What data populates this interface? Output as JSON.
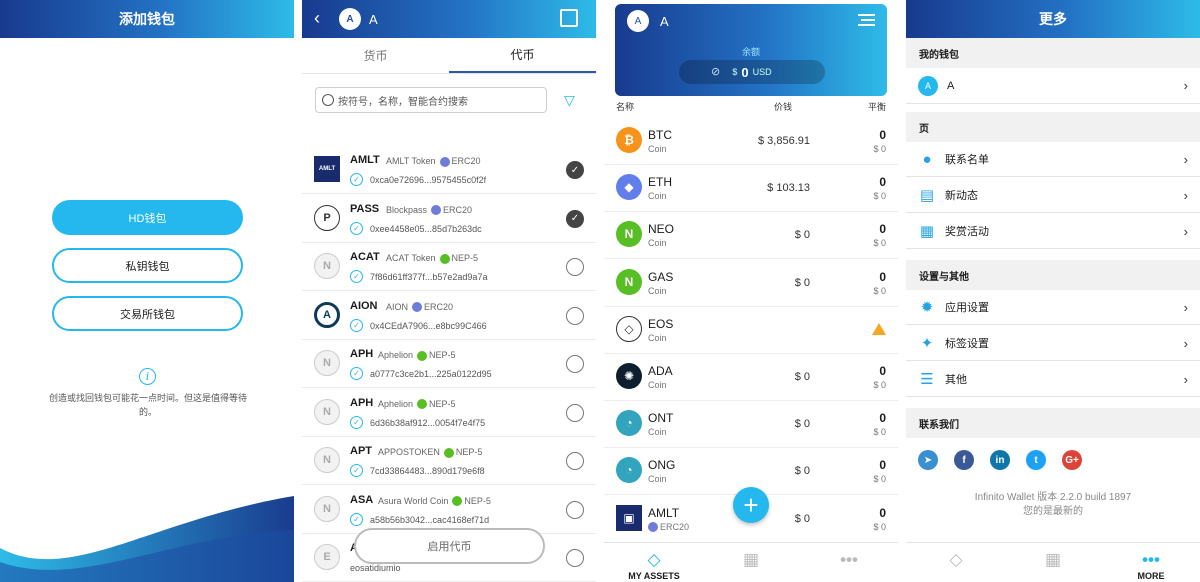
{
  "panel1": {
    "title": "添加钱包",
    "buttons": [
      "HD钱包",
      "私钥钱包",
      "交易所钱包"
    ],
    "info": "i",
    "note": "创造或找回钱包可能花一点时间。但这是值得等待的。"
  },
  "panel2": {
    "wallet_initial": "A",
    "wallet_name": "A",
    "tabs": [
      "货币",
      "代币"
    ],
    "search_placeholder": "按符号，名称，智能合约搜索",
    "tokens": [
      {
        "symbol": "AMLT",
        "name": "AMLT Token",
        "standard": "ERC20",
        "address": "0xca0e72696...9575455c0f2f",
        "selected": true,
        "logo": "AMLT"
      },
      {
        "symbol": "PASS",
        "name": "Blockpass",
        "standard": "ERC20",
        "address": "0xee4458e05...85d7b263dc",
        "selected": true,
        "logo": "P"
      },
      {
        "symbol": "ACAT",
        "name": "ACAT Token",
        "standard": "NEP-5",
        "address": "7f86d61ff377f...b57e2ad9a7a",
        "selected": false,
        "logo": "N"
      },
      {
        "symbol": "AION",
        "name": "AION",
        "standard": "ERC20",
        "address": "0x4CEdA7906...e8bc99C466",
        "selected": false,
        "logo": "A"
      },
      {
        "symbol": "APH",
        "name": "Aphelion",
        "standard": "NEP-5",
        "address": "a0777c3ce2b1...225a0122d95",
        "selected": false,
        "logo": "N"
      },
      {
        "symbol": "APH",
        "name": "Aphelion",
        "standard": "NEP-5",
        "address": "6d36b38af912...0054f7e4f75",
        "selected": false,
        "logo": "N"
      },
      {
        "symbol": "APT",
        "name": "APPOSTOKEN",
        "standard": "NEP-5",
        "address": "7cd33864483...890d179e6f8",
        "selected": false,
        "logo": "N"
      },
      {
        "symbol": "ASA",
        "name": "Asura World Coin",
        "standard": "NEP-5",
        "address": "a58b56b3042...cac4168ef71d",
        "selected": false,
        "logo": "N"
      },
      {
        "symbol": "A",
        "name": "",
        "standard": "",
        "address": "eosatidiumio",
        "selected": false,
        "logo": "E"
      }
    ],
    "enable_button": "启用代币"
  },
  "panel3": {
    "wallet_initial": "A",
    "wallet_name": "A",
    "balance_label": "余额",
    "balance_currency": "$",
    "balance_value": "0",
    "balance_unit": "USD",
    "columns": [
      "名称",
      "价钱",
      "平衡"
    ],
    "coins": [
      {
        "symbol": "BTC",
        "sub": "Coin",
        "price": "$ 3,856.91",
        "balance": "0",
        "usd": "$ 0",
        "color": "#f7931a",
        "glyph": "₿"
      },
      {
        "symbol": "ETH",
        "sub": "Coin",
        "price": "$ 103.13",
        "balance": "0",
        "usd": "$ 0",
        "color": "#627eea",
        "glyph": "◆"
      },
      {
        "symbol": "NEO",
        "sub": "Coin",
        "price": "$ 0",
        "balance": "0",
        "usd": "$ 0",
        "color": "#58be23",
        "glyph": "N"
      },
      {
        "symbol": "GAS",
        "sub": "Coin",
        "price": "$ 0",
        "balance": "0",
        "usd": "$ 0",
        "color": "#58be23",
        "glyph": "N"
      },
      {
        "symbol": "EOS",
        "sub": "Coin",
        "price": "",
        "balance": "",
        "usd": "",
        "color": "#ffffff",
        "glyph": "◇",
        "warning": "!"
      },
      {
        "symbol": "ADA",
        "sub": "Coin",
        "price": "$ 0",
        "balance": "0",
        "usd": "$ 0",
        "color": "#0d1e30",
        "glyph": "✺"
      },
      {
        "symbol": "ONT",
        "sub": "Coin",
        "price": "$ 0",
        "balance": "0",
        "usd": "$ 0",
        "color": "#32a4be",
        "glyph": "◔"
      },
      {
        "symbol": "ONG",
        "sub": "Coin",
        "price": "$ 0",
        "balance": "0",
        "usd": "$ 0",
        "color": "#32a4be",
        "glyph": "◔"
      },
      {
        "symbol": "AMLT",
        "sub": "ERC20",
        "price": "$ 0",
        "balance": "0",
        "usd": "$ 0",
        "color": "#1a2b6d",
        "glyph": "▣"
      }
    ],
    "fab": "+",
    "nav": [
      "MY ASSETS",
      "",
      ""
    ]
  },
  "panel4": {
    "title": "更多",
    "sections": {
      "wallet": "我的钱包",
      "pages": "页",
      "settings": "设置与其他",
      "contact": "联系我们"
    },
    "wallet_initial": "A",
    "wallet_name": "A",
    "page_items": [
      "联系名单",
      "新动态",
      "奖赏活动"
    ],
    "setting_items": [
      "应用设置",
      "标签设置",
      "其他"
    ],
    "social": [
      "telegram-icon",
      "facebook-icon",
      "linkedin-icon",
      "twitter-icon",
      "google-plus-icon"
    ],
    "version": "Infinito Wallet 版本 2.2.0 build 1897",
    "latest": "您的是最新的",
    "nav_more": "MORE"
  }
}
